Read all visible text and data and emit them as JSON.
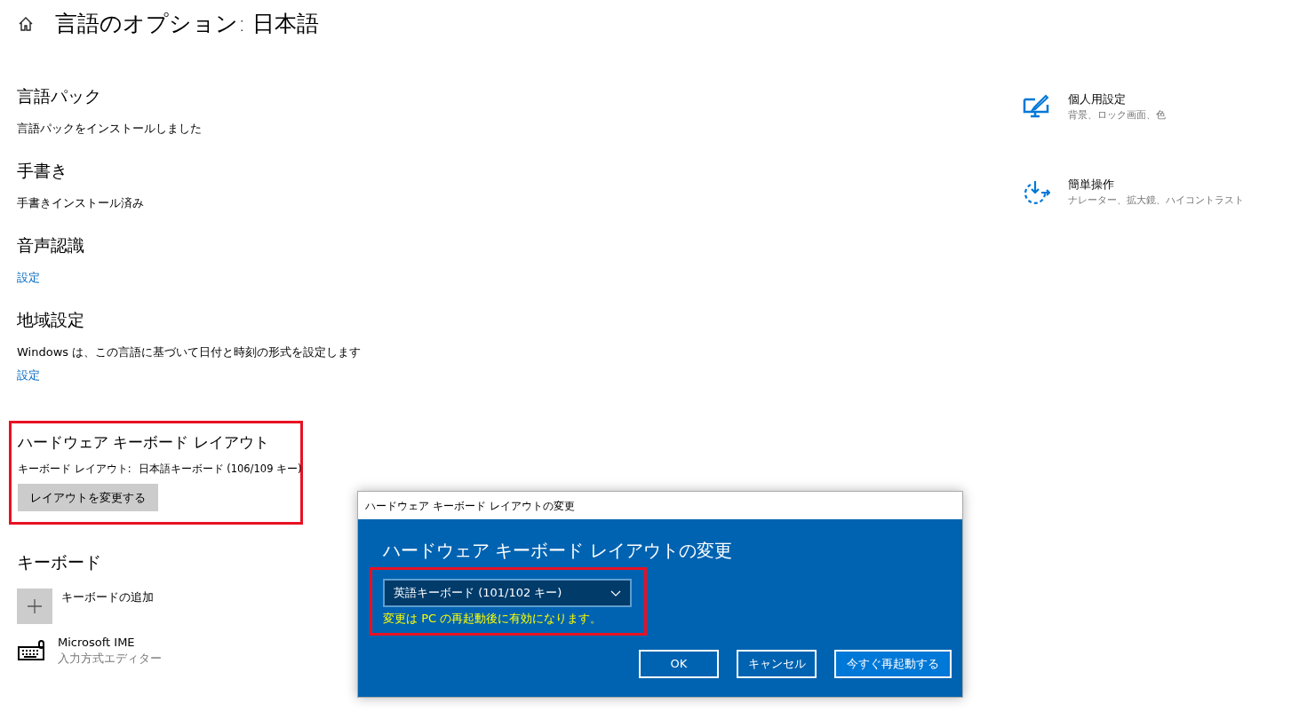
{
  "page": {
    "title": "言語のオプション: 日本語"
  },
  "sections": [
    {
      "heading": "言語パック",
      "text": "言語パックをインストールしました"
    },
    {
      "heading": "手書き",
      "text": "手書きインストール済み"
    },
    {
      "heading": "音声認識",
      "link": "設定"
    },
    {
      "heading": "地域設定",
      "text": "Windows は、この言語に基づいて日付と時刻の形式を設定します",
      "link": "設定"
    }
  ],
  "hardware_layout": {
    "heading": "ハードウェア キーボード レイアウト",
    "label": "キーボード レイアウト:",
    "value": "日本語キーボード (106/109 キー)",
    "button": "レイアウトを変更する",
    "highlighted": true
  },
  "keyboard": {
    "heading": "キーボード",
    "add_label": "キーボードの追加",
    "items": [
      {
        "name": "Microsoft IME",
        "description": "入力方式エディター"
      }
    ]
  },
  "related": [
    {
      "kind": "personalize",
      "title": "個人用設定",
      "subtitle": "背景、ロック画面、色"
    },
    {
      "kind": "ease",
      "title": "簡単操作",
      "subtitle": "ナレーター、拡大鏡、ハイコントラスト"
    }
  ],
  "dialog": {
    "window_title": "ハードウェア キーボード レイアウトの変更",
    "heading": "ハードウェア キーボード レイアウトの変更",
    "select_value": "英語キーボード (101/102 キー)",
    "notice": "変更は PC の再起動後に有効になります。",
    "highlighted": true,
    "buttons": [
      {
        "label": "OK",
        "primary": false
      },
      {
        "label": "キャンセル",
        "primary": false
      },
      {
        "label": "今すぐ再起動する",
        "primary": true
      }
    ]
  }
}
